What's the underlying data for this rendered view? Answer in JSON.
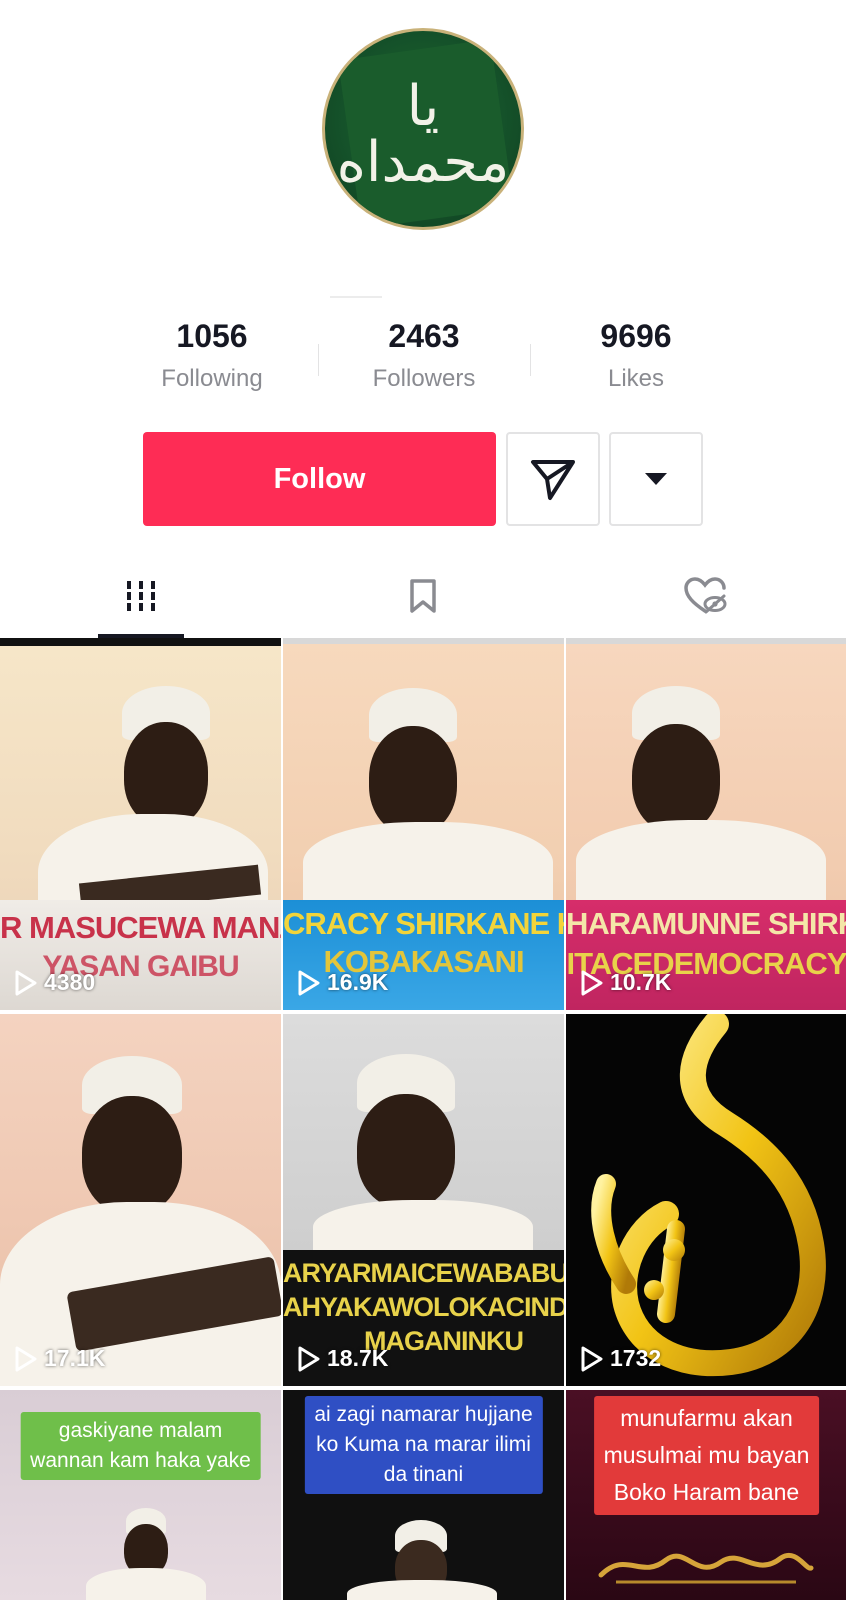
{
  "profile": {
    "avatar_alt": "green calligraphy avatar",
    "avatar_text": "يا محمداه"
  },
  "stats": [
    {
      "value": "1056",
      "label": "Following"
    },
    {
      "value": "2463",
      "label": "Followers"
    },
    {
      "value": "9696",
      "label": "Likes"
    }
  ],
  "actions": {
    "follow_label": "Follow",
    "message_icon": "send-icon",
    "more_icon": "caret-down-icon"
  },
  "tabs": [
    {
      "icon": "grid-icon",
      "selected": true
    },
    {
      "icon": "bookmark-icon",
      "selected": false
    },
    {
      "icon": "liked-hidden-icon",
      "selected": false
    }
  ],
  "videos": [
    {
      "views": "4380",
      "caption_line1": "R MASUCEWA MANZONA",
      "caption_line2": "YASAN GAIBU"
    },
    {
      "views": "16.9K",
      "caption_line1": "CRACY SHIRKANE KO.KA",
      "caption_line2": "KOBAKASANI"
    },
    {
      "views": "10.7K",
      "caption_line1": "HARAMUNNE SHIRKA",
      "caption_line2": "ITACEDEMOCRACY"
    },
    {
      "views": "17.1K"
    },
    {
      "views": "18.7K",
      "caption_line1": "ARYARMAICEWABABUALLA",
      "caption_line2": "AHYAKAWOLOKACINDAZAI",
      "caption_line3": "MAGANINKU"
    },
    {
      "views": "1732"
    },
    {
      "bubble_lines": [
        "gaskiyane malam",
        "wannan kam haka yake"
      ]
    },
    {
      "bubble_lines": [
        "ai zagi namarar hujjane",
        "ko Kuma na marar ilimi",
        "da tinani"
      ]
    },
    {
      "bubble_lines": [
        "munufarmu akan",
        "musulmai mu bayan",
        "Boko Haram bane"
      ]
    }
  ],
  "colors": {
    "follow": "#fe2c55",
    "text": "#161823",
    "muted": "#8a8b91",
    "border": "#e3e3e4"
  }
}
